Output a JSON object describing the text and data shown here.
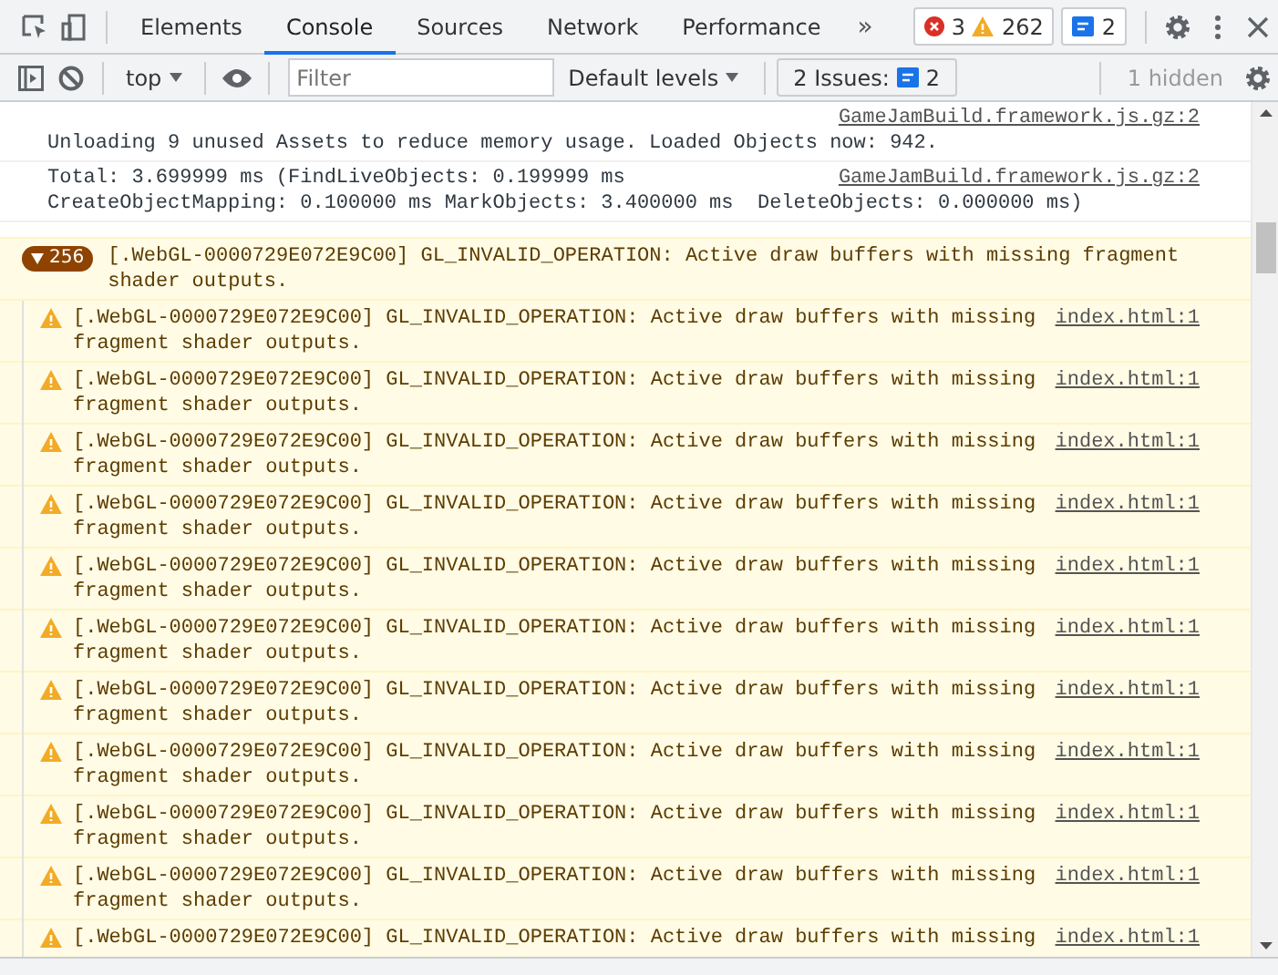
{
  "tabs": [
    {
      "label": "Elements",
      "selected": false
    },
    {
      "label": "Console",
      "selected": true
    },
    {
      "label": "Sources",
      "selected": false
    },
    {
      "label": "Network",
      "selected": false
    },
    {
      "label": "Performance",
      "selected": false
    }
  ],
  "more_tabs": "»",
  "counts": {
    "errors": "3",
    "warnings": "262",
    "messages": "2"
  },
  "toolbar": {
    "context": "top",
    "filter_placeholder": "Filter",
    "levels": "Default levels",
    "issues_label": "2 Issues:",
    "issues_count": "2",
    "hidden": "1 hidden"
  },
  "messages": [
    {
      "kind": "log",
      "text": "Unloading 9 unused Assets to reduce memory usage. Loaded Objects now: 942.",
      "source": "GameJamBuild.framework.js.gz:2"
    },
    {
      "kind": "log",
      "text": "Total: 3.699999 ms (FindLiveObjects: 0.199999 ms\nCreateObjectMapping: 0.100000 ms MarkObjects: 3.400000 ms  DeleteObjects: 0.000000 ms)",
      "source": "GameJamBuild.framework.js.gz:2"
    },
    {
      "kind": "group",
      "expanded": true,
      "count": "256",
      "text": "[.WebGL-0000729E072E9C00] GL_INVALID_OPERATION: Active draw buffers with missing fragment shader outputs."
    },
    {
      "kind": "warning",
      "text": "[.WebGL-0000729E072E9C00] GL_INVALID_OPERATION: Active draw buffers with missing fragment shader outputs.",
      "source": "index.html:1"
    },
    {
      "kind": "warning",
      "text": "[.WebGL-0000729E072E9C00] GL_INVALID_OPERATION: Active draw buffers with missing fragment shader outputs.",
      "source": "index.html:1"
    },
    {
      "kind": "warning",
      "text": "[.WebGL-0000729E072E9C00] GL_INVALID_OPERATION: Active draw buffers with missing fragment shader outputs.",
      "source": "index.html:1"
    },
    {
      "kind": "warning",
      "text": "[.WebGL-0000729E072E9C00] GL_INVALID_OPERATION: Active draw buffers with missing fragment shader outputs.",
      "source": "index.html:1"
    },
    {
      "kind": "warning",
      "text": "[.WebGL-0000729E072E9C00] GL_INVALID_OPERATION: Active draw buffers with missing fragment shader outputs.",
      "source": "index.html:1"
    },
    {
      "kind": "warning",
      "text": "[.WebGL-0000729E072E9C00] GL_INVALID_OPERATION: Active draw buffers with missing fragment shader outputs.",
      "source": "index.html:1"
    },
    {
      "kind": "warning",
      "text": "[.WebGL-0000729E072E9C00] GL_INVALID_OPERATION: Active draw buffers with missing fragment shader outputs.",
      "source": "index.html:1"
    },
    {
      "kind": "warning",
      "text": "[.WebGL-0000729E072E9C00] GL_INVALID_OPERATION: Active draw buffers with missing fragment shader outputs.",
      "source": "index.html:1"
    },
    {
      "kind": "warning",
      "text": "[.WebGL-0000729E072E9C00] GL_INVALID_OPERATION: Active draw buffers with missing fragment shader outputs.",
      "source": "index.html:1"
    },
    {
      "kind": "warning",
      "text": "[.WebGL-0000729E072E9C00] GL_INVALID_OPERATION: Active draw buffers with missing fragment shader outputs.",
      "source": "index.html:1"
    },
    {
      "kind": "warning",
      "text": "[.WebGL-0000729E072E9C00] GL_INVALID_OPERATION: Active draw buffers with missing",
      "source": "index.html:1"
    }
  ]
}
